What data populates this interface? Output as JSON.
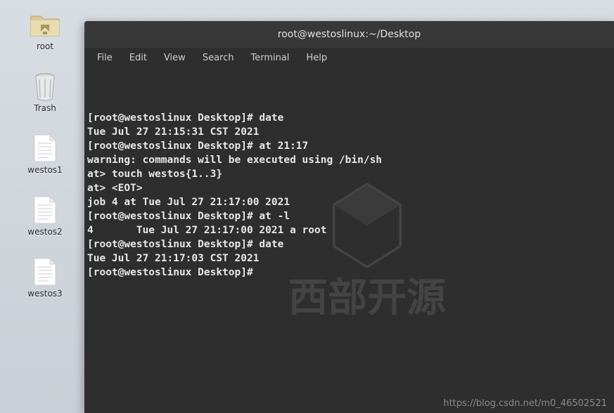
{
  "desktop": {
    "icons": [
      {
        "name": "root-folder",
        "label": "root",
        "type": "folder"
      },
      {
        "name": "trash",
        "label": "Trash",
        "type": "trash"
      },
      {
        "name": "file-westos1",
        "label": "westos1",
        "type": "file"
      },
      {
        "name": "file-westos2",
        "label": "westos2",
        "type": "file"
      },
      {
        "name": "file-westos3",
        "label": "westos3",
        "type": "file"
      }
    ]
  },
  "terminal": {
    "title": "root@westoslinux:~/Desktop",
    "menu": [
      "File",
      "Edit",
      "View",
      "Search",
      "Terminal",
      "Help"
    ],
    "lines": [
      "[root@westoslinux Desktop]# date",
      "Tue Jul 27 21:15:31 CST 2021",
      "[root@westoslinux Desktop]# at 21:17",
      "warning: commands will be executed using /bin/sh",
      "at> touch westos{1..3}",
      "at> <EOT>",
      "job 4 at Tue Jul 27 21:17:00 2021",
      "[root@westoslinux Desktop]# at -l",
      "4       Tue Jul 27 21:17:00 2021 a root",
      "[root@westoslinux Desktop]# date",
      "Tue Jul 27 21:17:03 CST 2021",
      "[root@westoslinux Desktop]# "
    ]
  },
  "watermark_text": "西部开源",
  "csdn": "https://blog.csdn.net/m0_46502521"
}
